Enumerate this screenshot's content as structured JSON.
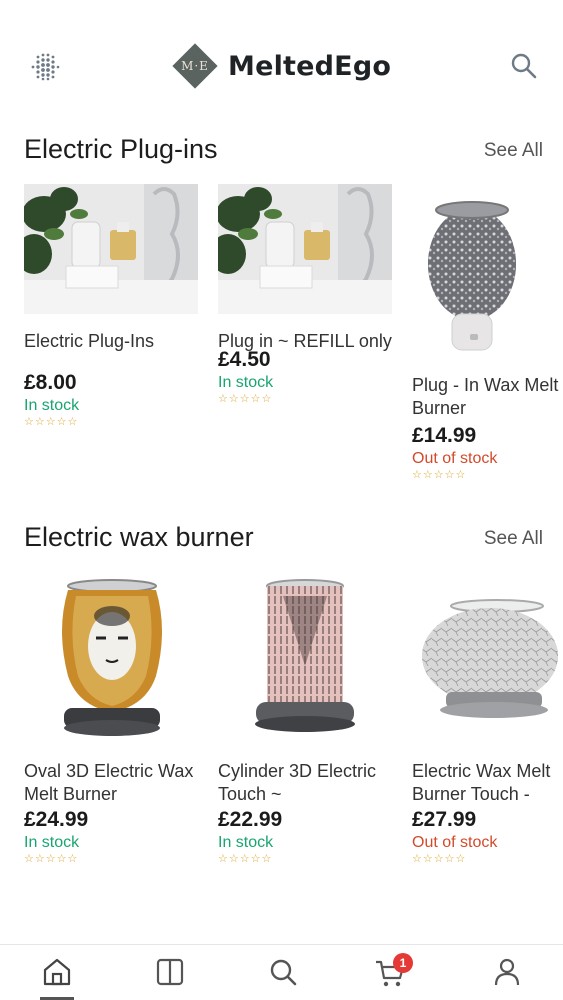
{
  "header": {
    "brand_name": "MeltedEgo",
    "logo_monogram": "M·E",
    "menu_icon": "dots-grid-icon",
    "search_icon": "search-icon"
  },
  "sections": [
    {
      "title": "Electric Plug-ins",
      "see_all": "See All",
      "products": [
        {
          "name": "Electric Plug-Ins",
          "price": "£8.00",
          "stock": "In stock",
          "rating": 0,
          "stars": "☆☆☆☆☆"
        },
        {
          "name": "Plug in ~ REFILL only",
          "price": "£4.50",
          "stock": "In stock",
          "rating": 0,
          "stars": "☆☆☆☆☆"
        },
        {
          "name": "Plug - In Wax Melt Burner",
          "price": "£14.99",
          "stock": "Out of stock",
          "rating": 0,
          "stars": "☆☆☆☆☆"
        }
      ]
    },
    {
      "title": "Electric wax burner",
      "see_all": "See All",
      "products": [
        {
          "name": "Oval 3D Electric Wax Melt Burner",
          "price": "£24.99",
          "stock": "In stock",
          "rating": 0,
          "stars": "☆☆☆☆☆"
        },
        {
          "name": "Cylinder 3D Electric Touch ~",
          "price": "£22.99",
          "stock": "In stock",
          "rating": 0,
          "stars": "☆☆☆☆☆"
        },
        {
          "name": "Electric Wax Melt Burner Touch -",
          "price": "£27.99",
          "stock": "Out of stock",
          "rating": 0,
          "stars": "☆☆☆☆☆"
        }
      ]
    }
  ],
  "tabbar": {
    "tabs": [
      {
        "icon": "home-icon",
        "active": true
      },
      {
        "icon": "book-icon",
        "active": false
      },
      {
        "icon": "search-icon",
        "active": false
      },
      {
        "icon": "cart-icon",
        "active": false
      },
      {
        "icon": "user-icon",
        "active": false
      }
    ],
    "cart_badge": "1"
  },
  "colors": {
    "in_stock": "#19a56f",
    "out_of_stock": "#d34a2b",
    "badge": "#e53935",
    "logo": "#5a6360"
  }
}
